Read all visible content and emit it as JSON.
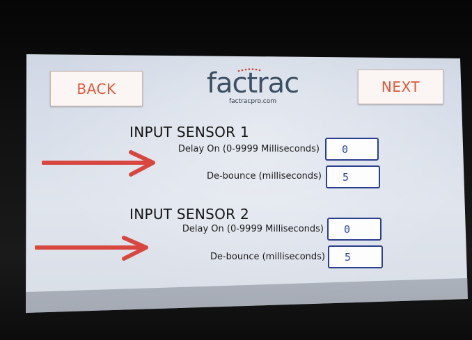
{
  "buttons": {
    "back_label": "BACK",
    "next_label": "NEXT"
  },
  "logo": {
    "brand": "factrac",
    "url": "factracpro.com"
  },
  "sensor1": {
    "title": "INPUT SENSOR 1",
    "delay_label": "Delay On (0-9999 Milliseconds)",
    "delay_value": "0",
    "debounce_label": "De-bounce (milliseconds)",
    "debounce_value": "5"
  },
  "sensor2": {
    "title": "INPUT SENSOR 2",
    "delay_label": "Delay On (0-9999 Milliseconds)",
    "delay_value": "0",
    "debounce_label": "De-bounce (milliseconds)",
    "debounce_value": "5"
  },
  "annotations": {
    "arrow_color": "#d8473f",
    "arrow_icon": "right-arrow-icon"
  },
  "colors": {
    "button_text": "#e0573a",
    "value_border": "#2b3f8a",
    "value_text": "#2e4a9c",
    "logo_text": "#3d4f63"
  }
}
